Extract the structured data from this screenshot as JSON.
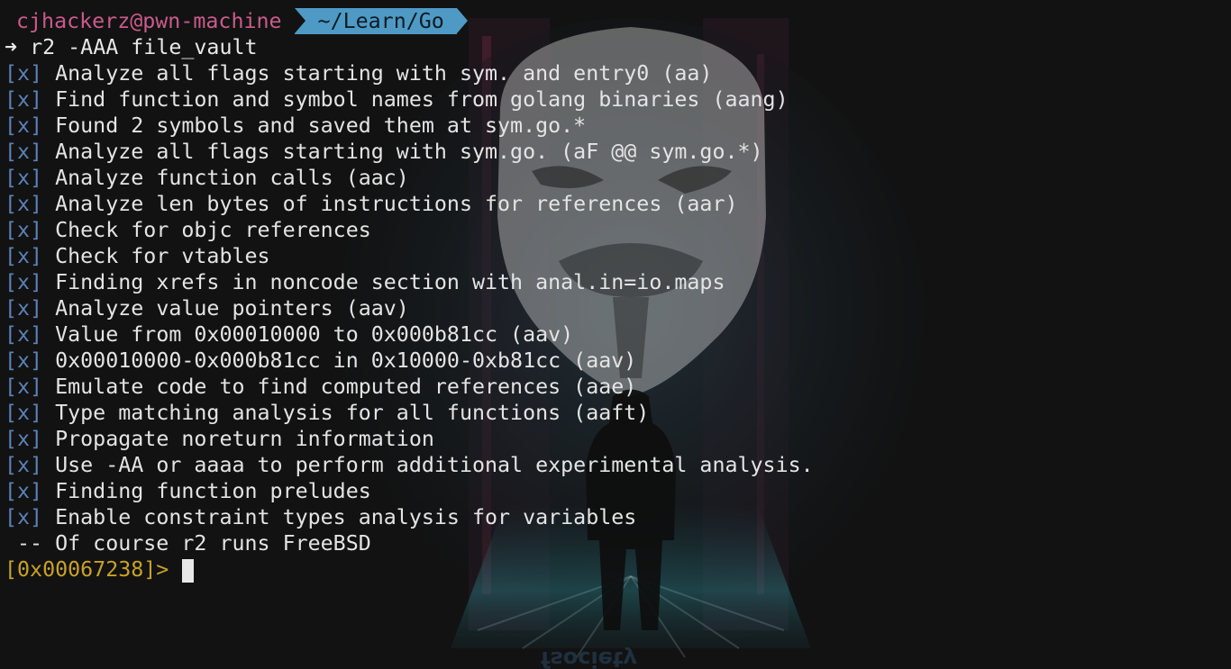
{
  "prompt": {
    "user_host": "cjhackerz@pwn-machine",
    "path": "~/Learn/Go",
    "arrow_glyph": "➜",
    "command": "r2 -AAA file_vault"
  },
  "analysis_log": [
    {
      "tag": "[x]",
      "text": "Analyze all flags starting with sym. and entry0 (aa)"
    },
    {
      "tag": "[x]",
      "text": "Find function and symbol names from golang binaries (aang)"
    },
    {
      "tag": "[x]",
      "text": "Found 2 symbols and saved them at sym.go.*"
    },
    {
      "tag": "[x]",
      "text": "Analyze all flags starting with sym.go. (aF @@ sym.go.*)"
    },
    {
      "tag": "[x]",
      "text": "Analyze function calls (aac)"
    },
    {
      "tag": "[x]",
      "text": "Analyze len bytes of instructions for references (aar)"
    },
    {
      "tag": "[x]",
      "text": "Check for objc references"
    },
    {
      "tag": "[x]",
      "text": "Check for vtables"
    },
    {
      "tag": "[x]",
      "text": "Finding xrefs in noncode section with anal.in=io.maps"
    },
    {
      "tag": "[x]",
      "text": "Analyze value pointers (aav)"
    },
    {
      "tag": "[x]",
      "text": "Value from 0x00010000 to 0x000b81cc (aav)"
    },
    {
      "tag": "[x]",
      "text": "0x00010000-0x000b81cc in 0x10000-0xb81cc (aav)"
    },
    {
      "tag": "[x]",
      "text": "Emulate code to find computed references (aae)"
    },
    {
      "tag": "[x]",
      "text": "Type matching analysis for all functions (aaft)"
    },
    {
      "tag": "[x]",
      "text": "Propagate noreturn information"
    },
    {
      "tag": "[x]",
      "text": "Use -AA or aaaa to perform additional experimental analysis."
    },
    {
      "tag": "[x]",
      "text": "Finding function preludes"
    },
    {
      "tag": "[x]",
      "text": "Enable constraint types analysis for variables"
    }
  ],
  "fortune": " -- Of course r2 runs FreeBSD",
  "r2_prompt": "[0x00067238]> ",
  "colors": {
    "background": "#121212",
    "user_host": "#c95b8c",
    "path_bg": "#4e9ac5",
    "tag": "#5b82b8",
    "r2_prompt": "#c9a227",
    "text": "#e4e4e4"
  }
}
